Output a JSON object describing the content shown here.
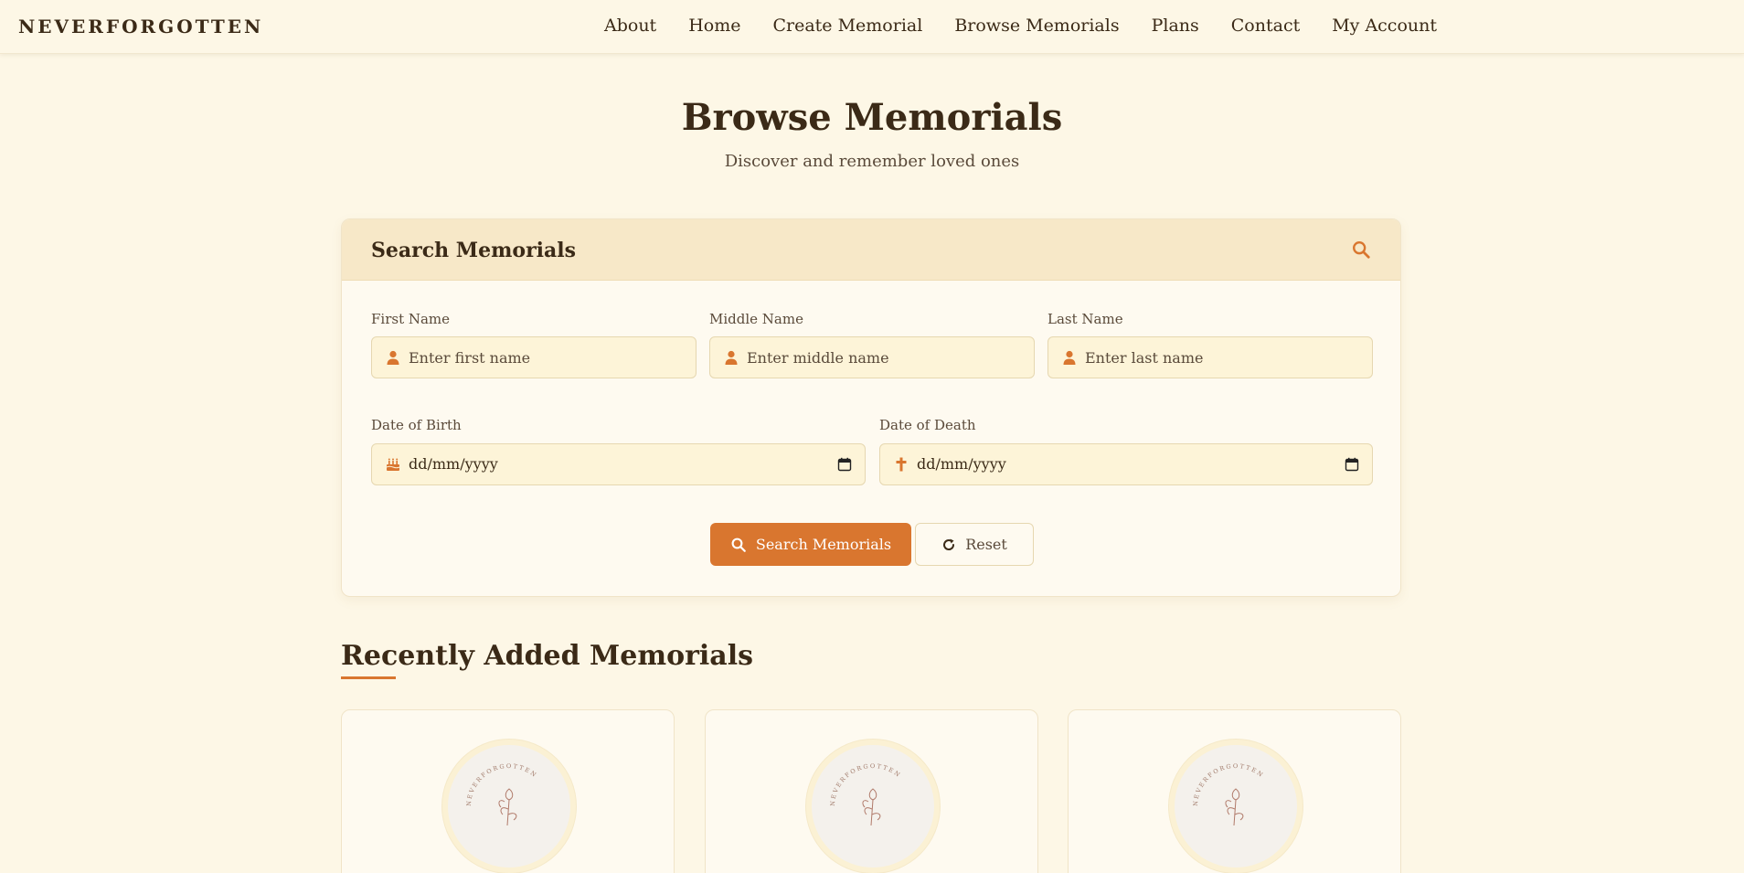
{
  "brand": "NEVERFORGOTTEN",
  "nav": [
    "About",
    "Home",
    "Create Memorial",
    "Browse Memorials",
    "Plans",
    "Contact",
    "My Account"
  ],
  "page": {
    "title": "Browse Memorials",
    "subtitle": "Discover and remember loved ones"
  },
  "search": {
    "title": "Search Memorials",
    "first_name": {
      "label": "First Name",
      "placeholder": "Enter first name"
    },
    "middle_name": {
      "label": "Middle Name",
      "placeholder": "Enter middle name"
    },
    "last_name": {
      "label": "Last Name",
      "placeholder": "Enter last name"
    },
    "dob": {
      "label": "Date of Birth",
      "value": "dd/mm/yyyy"
    },
    "dod": {
      "label": "Date of Death",
      "value": "dd/mm/yyyy"
    },
    "search_button": "Search Memorials",
    "reset_button": "Reset"
  },
  "recent": {
    "title": "Recently Added Memorials",
    "logo_text": "NEVERFORGOTTEN"
  },
  "colors": {
    "accent": "#d9762f",
    "background": "#fdf7e6",
    "card_header": "#f7e8c8",
    "text": "#3b2a17"
  }
}
